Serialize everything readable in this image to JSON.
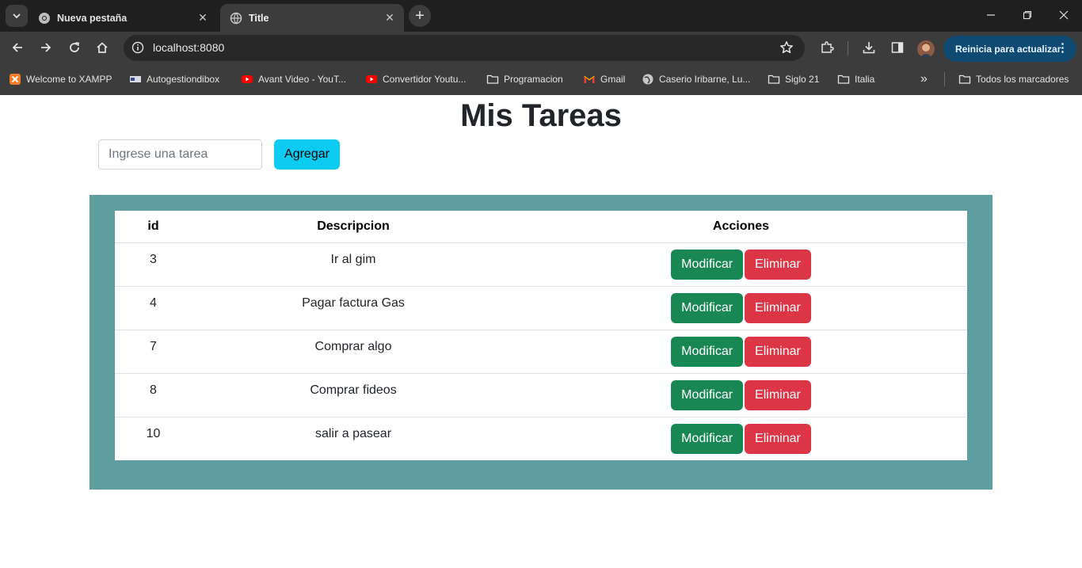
{
  "browser": {
    "tabs": [
      {
        "title": "Nueva pestaña",
        "active": false
      },
      {
        "title": "Title",
        "active": true
      }
    ],
    "url": "localhost:8080",
    "update_button": "Reinicia para actualizar",
    "bookmarks": [
      {
        "label": "Welcome to XAMPP",
        "icon": "xampp-icon"
      },
      {
        "label": "Autogestiondibox",
        "icon": "dibox-icon"
      },
      {
        "label": "Avant Video - YouT...",
        "icon": "youtube-icon"
      },
      {
        "label": "Convertidor Youtu...",
        "icon": "youtube-icon"
      },
      {
        "label": "Programacion",
        "icon": "folder-icon"
      },
      {
        "label": "Gmail",
        "icon": "gmail-icon"
      },
      {
        "label": "Caserio Iribarne, Lu...",
        "icon": "globe-icon"
      },
      {
        "label": "Siglo 21",
        "icon": "folder-icon"
      },
      {
        "label": "Italia",
        "icon": "folder-icon"
      }
    ],
    "all_bookmarks": "Todos los marcadores"
  },
  "page": {
    "title": "Mis Tareas",
    "input_placeholder": "Ingrese una tarea",
    "add_label": "Agregar",
    "table": {
      "headers": [
        "id",
        "Descripcion",
        "Acciones"
      ],
      "rows": [
        {
          "id": "3",
          "desc": "Ir al gim"
        },
        {
          "id": "4",
          "desc": "Pagar factura Gas"
        },
        {
          "id": "7",
          "desc": "Comprar algo"
        },
        {
          "id": "8",
          "desc": "Comprar fideos"
        },
        {
          "id": "10",
          "desc": "salir a pasear"
        }
      ],
      "modify_label": "Modificar",
      "delete_label": "Eliminar"
    }
  },
  "colors": {
    "table_background": "#5f9ea0",
    "add_button": "#0dcaf0",
    "modify_button": "#198754",
    "delete_button": "#dc3545"
  }
}
